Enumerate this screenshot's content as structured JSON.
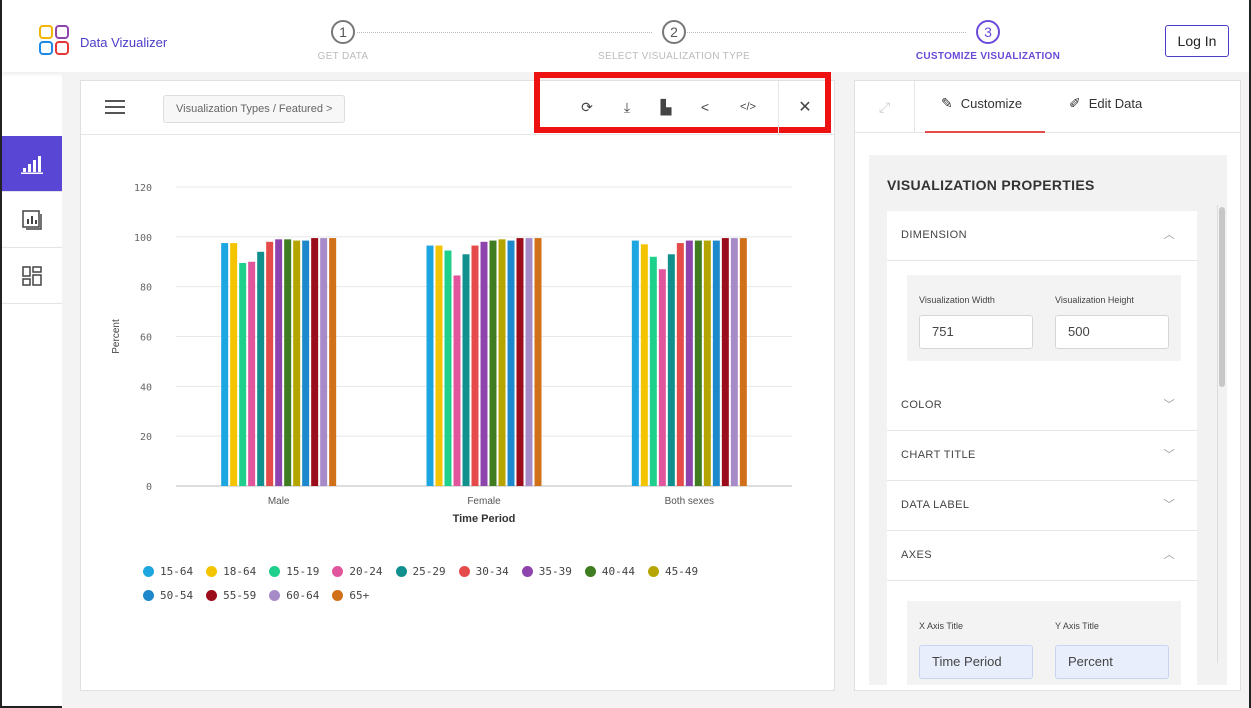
{
  "app": {
    "brand": "Data Vizualizer",
    "login_label": "Log In"
  },
  "steps": [
    {
      "num": "1",
      "label": "GET DATA",
      "active": false
    },
    {
      "num": "2",
      "label": "SELECT VISUALIZATION TYPE",
      "active": false
    },
    {
      "num": "3",
      "label": "CUSTOMIZE VISUALIZATION",
      "active": true
    }
  ],
  "rail": [
    {
      "icon": "bar-chart-icon",
      "active": true
    },
    {
      "icon": "report-icon",
      "active": false
    },
    {
      "icon": "dashboard-icon",
      "active": false
    }
  ],
  "toolbar": {
    "breadcrumb": "Visualization Types / Featured  >",
    "tools": [
      {
        "icon": "refresh-icon",
        "glyph": "⟳"
      },
      {
        "icon": "download-icon",
        "glyph": "⤓"
      },
      {
        "icon": "save-icon",
        "glyph": "▙"
      },
      {
        "icon": "share-icon",
        "glyph": "<"
      },
      {
        "icon": "embed-code-icon",
        "glyph": "</>"
      }
    ],
    "close_glyph": "✕"
  },
  "right_panel": {
    "tabs": [
      {
        "label": "Customize",
        "icon": "pencil-icon",
        "active": true
      },
      {
        "label": "Edit Data",
        "icon": "edit-icon",
        "active": false
      }
    ],
    "title": "VISUALIZATION PROPERTIES",
    "sections": {
      "dimension": "DIMENSION",
      "color": "COLOR",
      "chart_title": "CHART TITLE",
      "data_label": "DATA LABEL",
      "axes": "AXES"
    },
    "dimension_fields": {
      "width_label": "Visualization Width",
      "width_value": "751",
      "height_label": "Visualization Height",
      "height_value": "500"
    },
    "axes_fields": {
      "x_label": "X Axis Title",
      "x_value": "Time Period",
      "y_label": "Y Axis Title",
      "y_value": "Percent"
    }
  },
  "chart_data": {
    "type": "bar",
    "xlabel": "Time Period",
    "ylabel": "Percent",
    "ylim": [
      0,
      120
    ],
    "yticks": [
      0,
      20,
      40,
      60,
      80,
      100,
      120
    ],
    "categories": [
      "Male",
      "Female",
      "Both sexes"
    ],
    "series": [
      {
        "name": "15-64",
        "color": "#1ea6e0",
        "values": [
          97.5,
          96.5,
          98.5
        ]
      },
      {
        "name": "18-64",
        "color": "#f5c400",
        "values": [
          97.5,
          96.5,
          97
        ]
      },
      {
        "name": "15-19",
        "color": "#1fcf8c",
        "values": [
          89.5,
          94.5,
          92
        ]
      },
      {
        "name": "20-24",
        "color": "#e0559b",
        "values": [
          90,
          84.5,
          87
        ]
      },
      {
        "name": "25-29",
        "color": "#12908d",
        "values": [
          94,
          93,
          93
        ]
      },
      {
        "name": "30-34",
        "color": "#e54b4b",
        "values": [
          98,
          96.5,
          97.5
        ]
      },
      {
        "name": "35-39",
        "color": "#8e44ad",
        "values": [
          99,
          98,
          98.5
        ]
      },
      {
        "name": "40-44",
        "color": "#3f7d20",
        "values": [
          99,
          98.5,
          98.5
        ]
      },
      {
        "name": "45-49",
        "color": "#b5a500",
        "values": [
          98.5,
          99,
          98.5
        ]
      },
      {
        "name": "50-54",
        "color": "#1e88cc",
        "values": [
          98.5,
          98.5,
          98.5
        ]
      },
      {
        "name": "55-59",
        "color": "#9c0d1c",
        "values": [
          99.5,
          99.5,
          99.5
        ]
      },
      {
        "name": "60-64",
        "color": "#a78bc9",
        "values": [
          99.5,
          99.5,
          99.5
        ]
      },
      {
        "name": "65+",
        "color": "#d07018",
        "values": [
          99.5,
          99.5,
          99.5
        ]
      }
    ]
  }
}
